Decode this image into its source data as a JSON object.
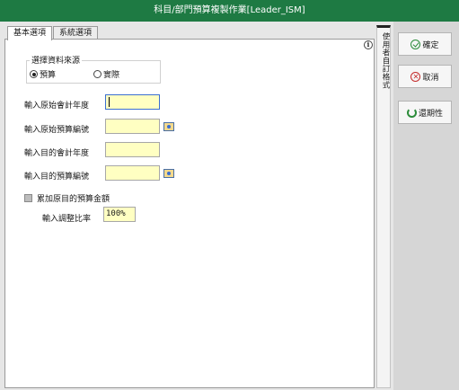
{
  "window": {
    "title": "科目/部門預算複製作業[Leader_ISM]"
  },
  "tabs": [
    {
      "label": "基本選項",
      "active": true
    },
    {
      "label": "系統選項",
      "active": false
    }
  ],
  "source_group": {
    "title": "選擇資料來源",
    "options": [
      {
        "label": "預算",
        "checked": true
      },
      {
        "label": "實際",
        "checked": false
      }
    ]
  },
  "fields": [
    {
      "label": "輸入原始會計年度",
      "value": "",
      "lookup": false
    },
    {
      "label": "輸入原始預算編號",
      "value": "",
      "lookup": true
    },
    {
      "label": "輸入目的會計年度",
      "value": "",
      "lookup": false
    },
    {
      "label": "輸入目的預算編號",
      "value": "",
      "lookup": true
    }
  ],
  "accumulate": {
    "label": "累加原目的預算金額",
    "checked": false
  },
  "ratio": {
    "label": "輸入調整比率",
    "value": "100%"
  },
  "side_tab": {
    "label": "使用者自訂格式"
  },
  "buttons": {
    "confirm": "確定",
    "cancel": "取消",
    "cancel_icon": "x-icon",
    "refresh": "還期性"
  },
  "colors": {
    "titlebar": "#1e7a43",
    "input_bg": "#ffffc2",
    "focus_border": "#3b6fd0"
  }
}
